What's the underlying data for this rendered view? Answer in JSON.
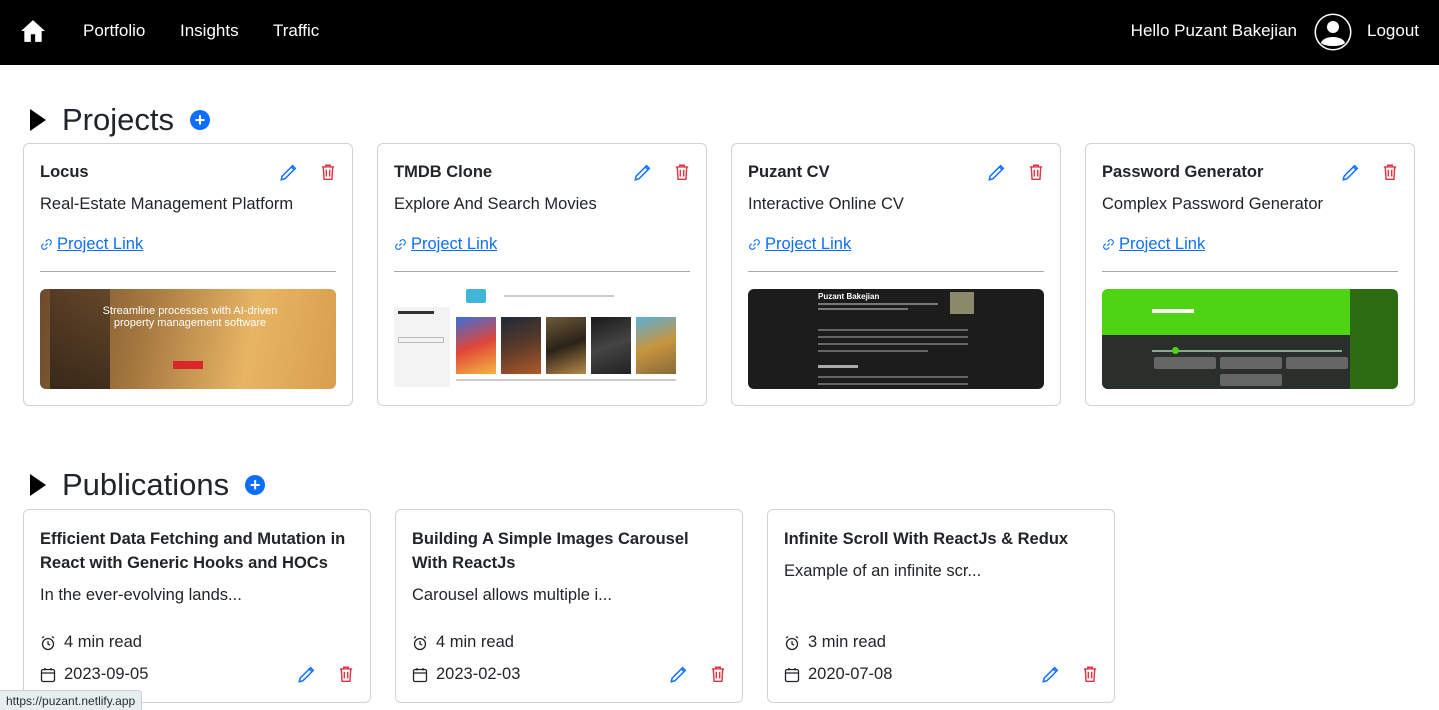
{
  "nav": {
    "home_icon": "house-icon",
    "links": [
      "Portfolio",
      "Insights",
      "Traffic"
    ],
    "greeting": "Hello Puzant Bakejian",
    "avatar_icon": "user-circle-icon",
    "logout": "Logout"
  },
  "projects": {
    "heading": "Projects",
    "add_label": "+",
    "link_label": " Project Link",
    "items": [
      {
        "title": "Locus",
        "subtitle": "Real-Estate Management Platform",
        "thumb_text": "Streamline processes with AI-driven property management software"
      },
      {
        "title": "TMDB Clone",
        "subtitle": "Explore And Search Movies"
      },
      {
        "title": "Puzant CV",
        "subtitle": "Interactive Online CV",
        "thumb_text": "Puzant Bakejian"
      },
      {
        "title": "Password Generator",
        "subtitle": "Complex Password Generator"
      }
    ]
  },
  "publications": {
    "heading": "Publications",
    "add_label": "+",
    "items": [
      {
        "title": "Efficient Data Fetching and Mutation in React with Generic Hooks and HOCs",
        "excerpt": "In the ever-evolving lands...",
        "read_time": "4 min read",
        "date": "2023-09-05"
      },
      {
        "title": "Building A Simple Images Carousel With ReactJs",
        "excerpt": "Carousel allows multiple i...",
        "read_time": "4 min read",
        "date": "2023-02-03"
      },
      {
        "title": "Infinite Scroll With ReactJs & Redux",
        "excerpt": "Example of an infinite scr...",
        "read_time": "3 min read",
        "date": "2020-07-08"
      }
    ]
  },
  "status_bar": {
    "url": "https://puzant.netlify.app"
  },
  "colors": {
    "accent": "#0d6efd",
    "danger": "#dc3545",
    "navbar": "#000000"
  }
}
